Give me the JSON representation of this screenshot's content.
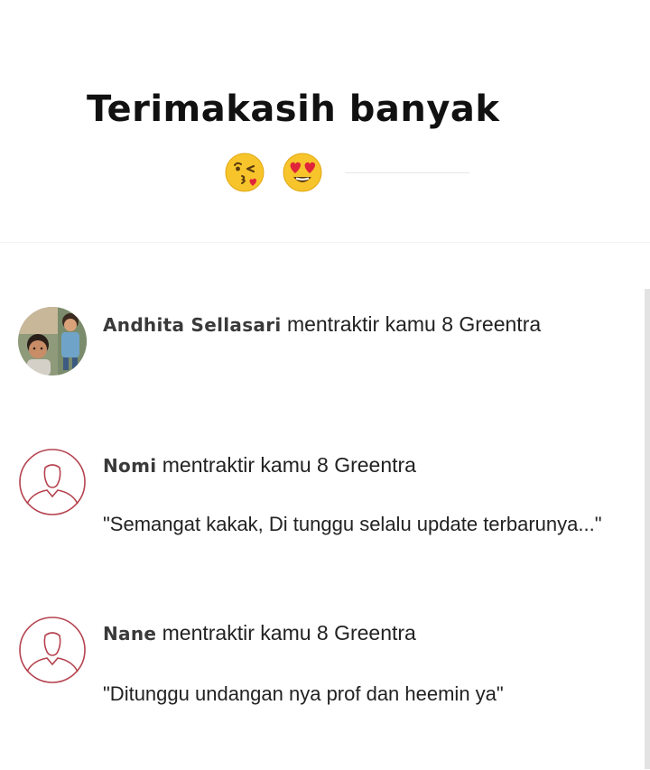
{
  "header": {
    "title": "Terimakasih banyak",
    "emojis": [
      "face-blowing-kiss-icon",
      "heart-eyes-icon"
    ]
  },
  "supporters": [
    {
      "name": "Andhita Sellasari",
      "action": "mentraktir kamu 8 Greentra",
      "message": "",
      "avatar": "photo-avatar"
    },
    {
      "name": "Nomi",
      "action": "mentraktir kamu 8 Greentra",
      "message": "\"Semangat kakak, Di tunggu selalu update terbarunya...\"",
      "avatar": "default-user-icon"
    },
    {
      "name": "Nane",
      "action": "mentraktir kamu 8 Greentra",
      "message": "\"Ditunggu undangan nya prof dan heemin ya\"",
      "avatar": "default-user-icon"
    }
  ],
  "colors": {
    "avatar_outline": "#b5434f",
    "emoji_yellow": "#f7c52b",
    "heart_red": "#e0253a"
  }
}
